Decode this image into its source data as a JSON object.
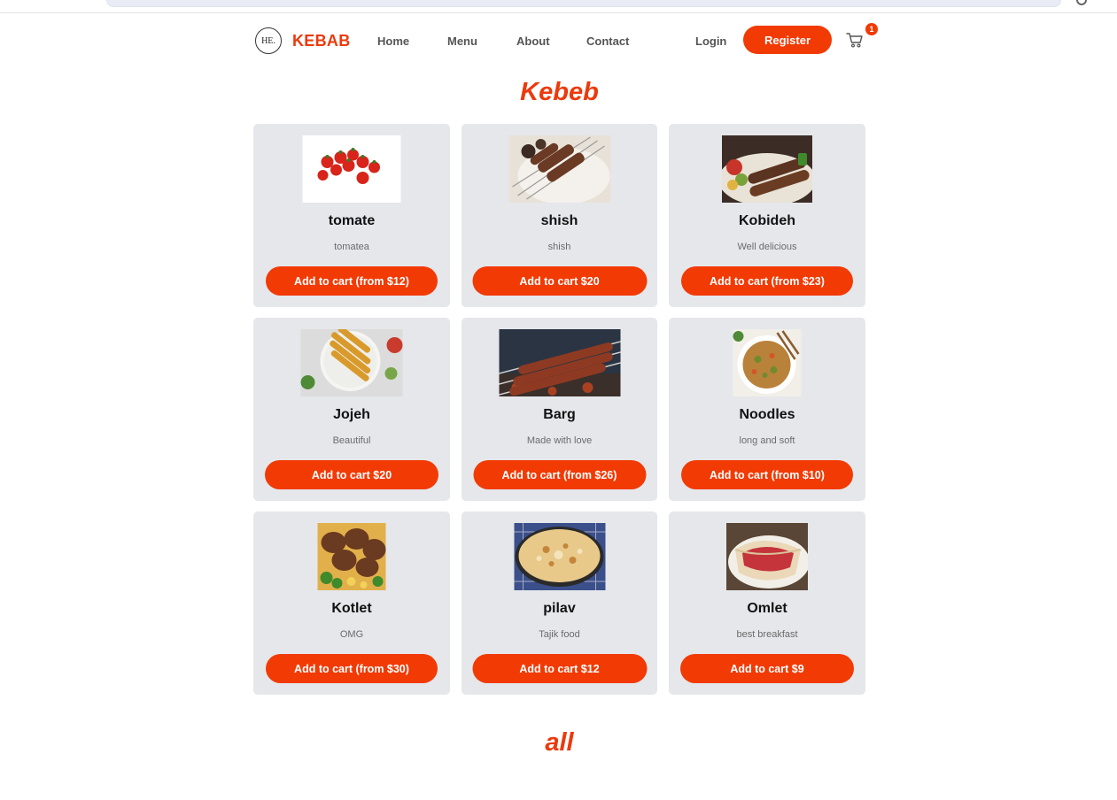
{
  "brand": {
    "logo_text": "HE.",
    "name": "KEBAB"
  },
  "nav": {
    "home": "Home",
    "menu": "Menu",
    "about": "About",
    "contact": "Contact",
    "login": "Login",
    "register": "Register",
    "cart_count": "1"
  },
  "sections": {
    "featured_title": "Kebeb",
    "all_title": "all"
  },
  "products": [
    {
      "name": "tomate",
      "description": "tomatea",
      "button": "Add to cart (from $12)",
      "image_icon": "tomatoes-image"
    },
    {
      "name": "shish",
      "description": "shish",
      "button": "Add to cart $20",
      "image_icon": "shish-kebab-image"
    },
    {
      "name": "Kobideh",
      "description": "Well delicious",
      "button": "Add to cart (from $23)",
      "image_icon": "kobideh-image"
    },
    {
      "name": "Jojeh",
      "description": "Beautiful",
      "button": "Add to cart $20",
      "image_icon": "jojeh-image"
    },
    {
      "name": "Barg",
      "description": "Made with love",
      "button": "Add to cart (from $26)",
      "image_icon": "barg-image"
    },
    {
      "name": "Noodles",
      "description": "long and soft",
      "button": "Add to cart (from $10)",
      "image_icon": "noodles-image"
    },
    {
      "name": "Kotlet",
      "description": "OMG",
      "button": "Add to cart (from $30)",
      "image_icon": "kotlet-image"
    },
    {
      "name": "pilav",
      "description": "Tajik food",
      "button": "Add to cart $12",
      "image_icon": "pilav-image"
    },
    {
      "name": "Omlet",
      "description": "best breakfast",
      "button": "Add to cart $9",
      "image_icon": "omlet-image"
    }
  ],
  "colors": {
    "accent": "#f23a04",
    "card_bg": "#e5e7eb"
  }
}
